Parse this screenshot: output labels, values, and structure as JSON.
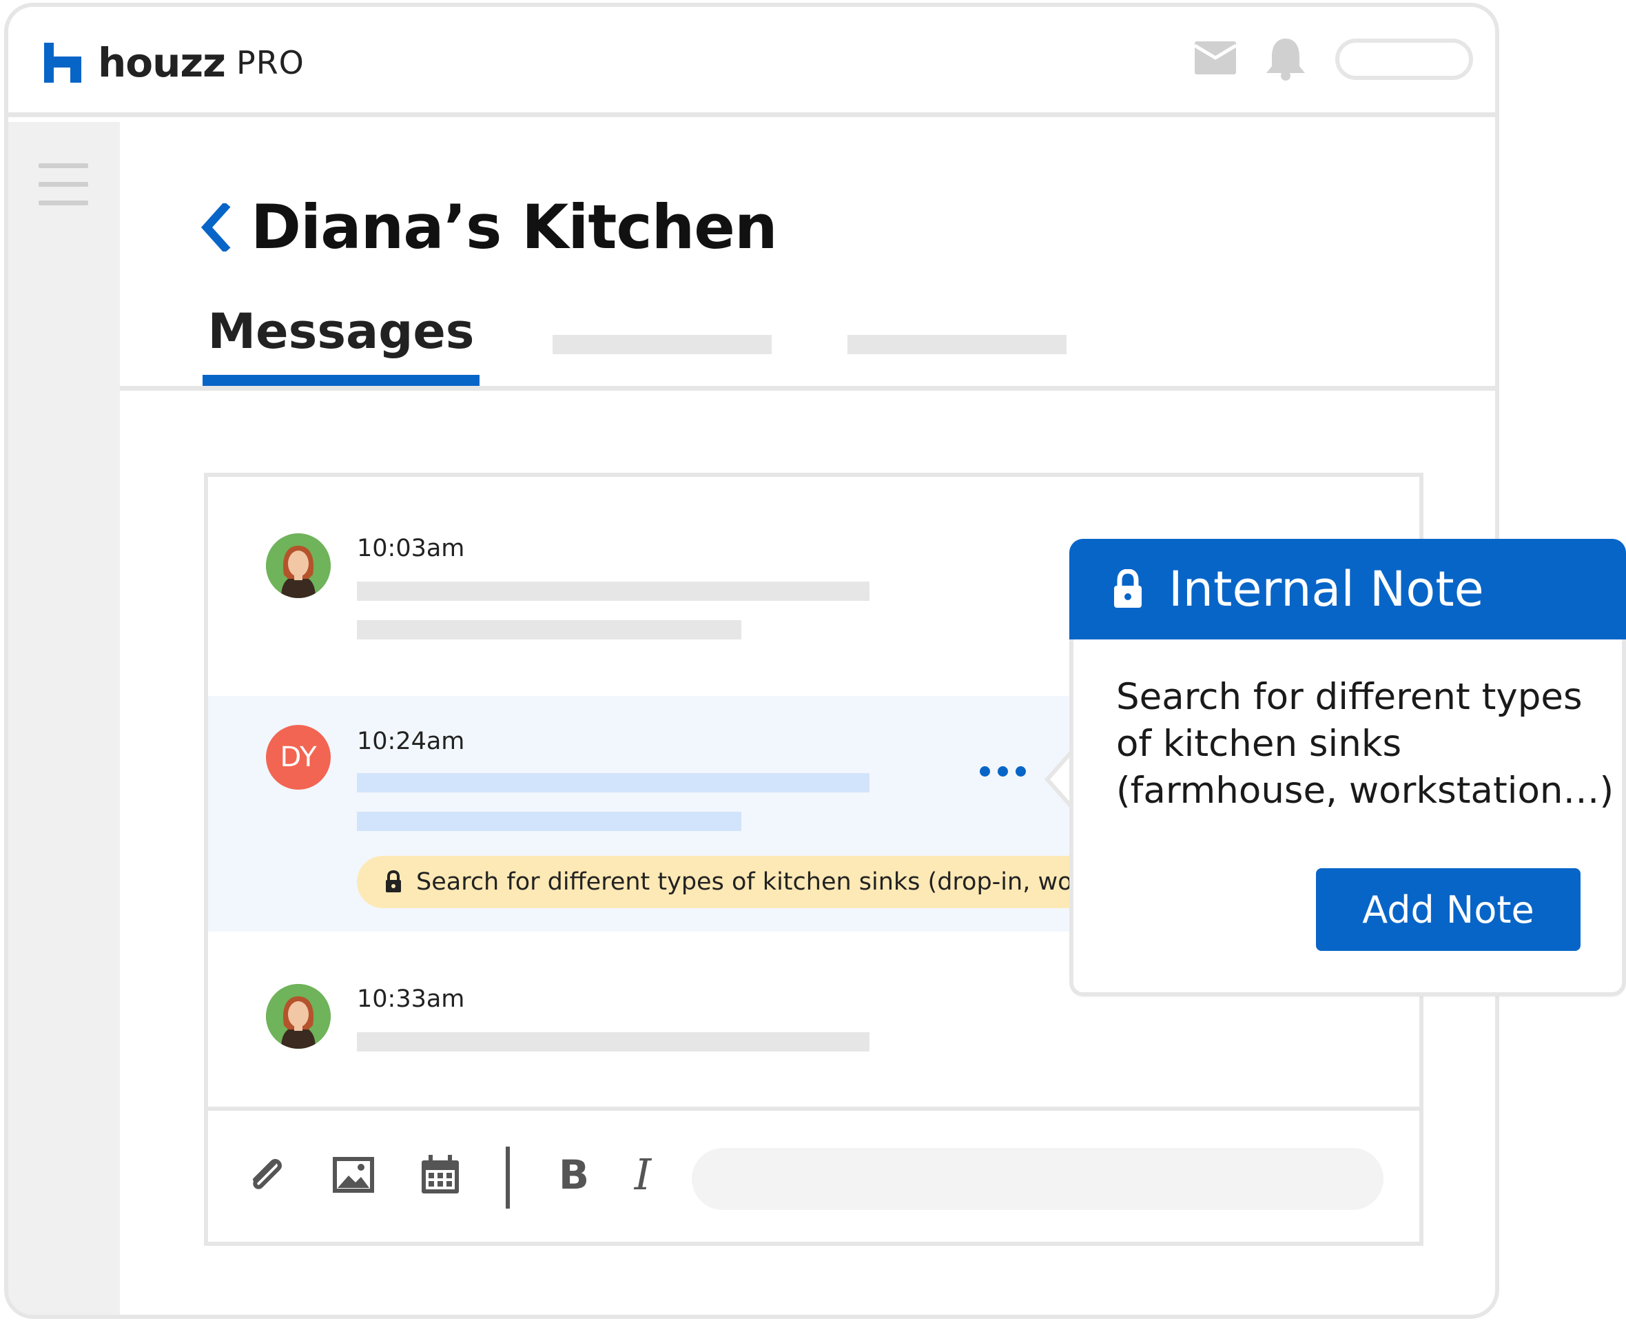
{
  "brand": {
    "name": "houzz",
    "suffix": "PRO",
    "accent": "#0865c8"
  },
  "header_icons": [
    "mail-icon",
    "bell-icon"
  ],
  "page": {
    "title": "Diana’s Kitchen"
  },
  "tabs": [
    {
      "label": "Messages",
      "active": true
    }
  ],
  "messages": [
    {
      "time": "10:03am",
      "avatar": "client-photo"
    },
    {
      "time": "10:24am",
      "avatar_initials": "DY",
      "note_text": "Search for different types of kitchen sinks (drop-in, work"
    },
    {
      "time": "10:33am",
      "avatar": "client-photo"
    }
  ],
  "composer": {
    "bold_label": "B",
    "italic_label": "I"
  },
  "internal_note": {
    "title": "Internal Note",
    "body": "Search for different types of kitchen sinks (farmhouse, workstation…)",
    "button_label": "Add Note"
  },
  "colors": {
    "primary": "#0865c8",
    "note_bg": "#fde9b5",
    "avatar_dy": "#f26552",
    "highlight_row": "#f2f7fd"
  }
}
